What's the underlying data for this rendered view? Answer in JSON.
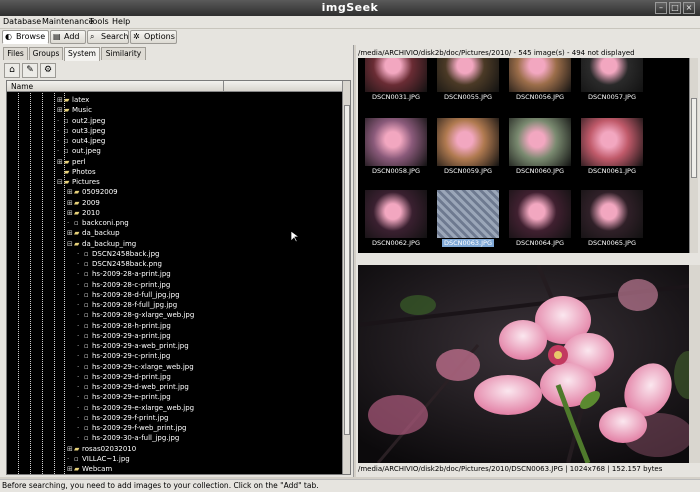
{
  "window": {
    "title": "imgSeek"
  },
  "menu": [
    "Database",
    "Maintenance",
    "Tools",
    "Help"
  ],
  "toolbar": [
    {
      "label": "Browse",
      "icon": "browse-icon",
      "active": true
    },
    {
      "label": "Add",
      "icon": "add-icon",
      "active": false
    },
    {
      "label": "Search",
      "icon": "search-icon",
      "active": false
    },
    {
      "label": "Options",
      "icon": "options-icon",
      "active": false
    }
  ],
  "left_tabs": [
    {
      "label": "Files",
      "active": false
    },
    {
      "label": "Groups",
      "active": false
    },
    {
      "label": "System",
      "active": true
    },
    {
      "label": "Similarity",
      "active": false
    }
  ],
  "tree": {
    "header": "Name",
    "rows": [
      {
        "label": "latex",
        "kind": "folder",
        "expand": "+"
      },
      {
        "label": "Music",
        "kind": "folder",
        "expand": "+"
      },
      {
        "label": "out2.jpeg",
        "kind": "file"
      },
      {
        "label": "out3.jpeg",
        "kind": "file"
      },
      {
        "label": "out4.jpeg",
        "kind": "file"
      },
      {
        "label": "out.jpeg",
        "kind": "file"
      },
      {
        "label": "perl",
        "kind": "folder",
        "expand": "+"
      },
      {
        "label": "Photos",
        "kind": "folder",
        "expand": ""
      },
      {
        "label": "Pictures",
        "kind": "folder",
        "expand": "-"
      },
      {
        "label": "05092009",
        "kind": "folder",
        "expand": "+",
        "depth": 1
      },
      {
        "label": "2009",
        "kind": "folder",
        "expand": "+",
        "depth": 1
      },
      {
        "label": "2010",
        "kind": "folder",
        "expand": "+",
        "depth": 1
      },
      {
        "label": "backconi.png",
        "kind": "file",
        "depth": 1
      },
      {
        "label": "da_backup",
        "kind": "folder",
        "expand": "+",
        "depth": 1
      },
      {
        "label": "da_backup_img",
        "kind": "folder",
        "expand": "-",
        "depth": 1
      },
      {
        "label": "DSCN2458back.jpg",
        "kind": "file",
        "depth": 2
      },
      {
        "label": "DSCN2458back.png",
        "kind": "file",
        "depth": 2
      },
      {
        "label": "hs-2009-28-a-print.jpg",
        "kind": "file",
        "depth": 2
      },
      {
        "label": "hs-2009-28-c-print.jpg",
        "kind": "file",
        "depth": 2
      },
      {
        "label": "hs-2009-28-d-full_jpg.jpg",
        "kind": "file",
        "depth": 2
      },
      {
        "label": "hs-2009-28-f-full_jpg.jpg",
        "kind": "file",
        "depth": 2
      },
      {
        "label": "hs-2009-28-g-xlarge_web.jpg",
        "kind": "file",
        "depth": 2
      },
      {
        "label": "hs-2009-28-h-print.jpg",
        "kind": "file",
        "depth": 2
      },
      {
        "label": "hs-2009-29-a-print.jpg",
        "kind": "file",
        "depth": 2
      },
      {
        "label": "hs-2009-29-a-web_print.jpg",
        "kind": "file",
        "depth": 2
      },
      {
        "label": "hs-2009-29-c-print.jpg",
        "kind": "file",
        "depth": 2
      },
      {
        "label": "hs-2009-29-c-xlarge_web.jpg",
        "kind": "file",
        "depth": 2
      },
      {
        "label": "hs-2009-29-d-print.jpg",
        "kind": "file",
        "depth": 2
      },
      {
        "label": "hs-2009-29-d-web_print.jpg",
        "kind": "file",
        "depth": 2
      },
      {
        "label": "hs-2009-29-e-print.jpg",
        "kind": "file",
        "depth": 2
      },
      {
        "label": "hs-2009-29-e-xlarge_web.jpg",
        "kind": "file",
        "depth": 2
      },
      {
        "label": "hs-2009-29-f-print.jpg",
        "kind": "file",
        "depth": 2
      },
      {
        "label": "hs-2009-29-f-web_print.jpg",
        "kind": "file",
        "depth": 2
      },
      {
        "label": "hs-2009-30-a-full_jpg.jpg",
        "kind": "file",
        "depth": 2
      },
      {
        "label": "rosas02032010",
        "kind": "folder",
        "expand": "+",
        "depth": 1
      },
      {
        "label": "VILLAC~1.jpg",
        "kind": "file",
        "depth": 1
      },
      {
        "label": "Webcam",
        "kind": "folder",
        "expand": "+",
        "depth": 1
      }
    ]
  },
  "browser": {
    "path_info": "/media/ARCHIVIO/disk2b/doc/Pictures/2010/ - 545 image(s) - 494 not displayed",
    "thumbs": [
      {
        "caption": "DSCN0031.JPG",
        "color": "#6a2c34"
      },
      {
        "caption": "DSCN0055.JPG",
        "color": "#4b3a26"
      },
      {
        "caption": "DSCN0056.JPG",
        "color": "#9c6e4a"
      },
      {
        "caption": "DSCN0057.JPG",
        "color": "#2a2a2a"
      },
      {
        "caption": "DSCN0058.JPG",
        "color": "#8a5a7a"
      },
      {
        "caption": "DSCN0059.JPG",
        "color": "#b07a50"
      },
      {
        "caption": "DSCN0060.JPG",
        "color": "#7a8a70"
      },
      {
        "caption": "DSCN0061.JPG",
        "color": "#c05a6a"
      },
      {
        "caption": "DSCN0062.JPG",
        "color": "#3a2030"
      },
      {
        "caption": "DSCN0063.JPG",
        "color": "#8090a8",
        "selected": true
      },
      {
        "caption": "DSCN0064.JPG",
        "color": "#402030"
      },
      {
        "caption": "DSCN0065.JPG",
        "color": "#302028"
      }
    ]
  },
  "preview": {
    "info": "/media/ARCHIVIO/disk2b/doc/Pictures/2010/DSCN0063.JPG | 1024x768 | 152.157 bytes"
  },
  "status": {
    "text": "Before searching, you need to add images to your collection. Click on the \"Add\" tab."
  }
}
